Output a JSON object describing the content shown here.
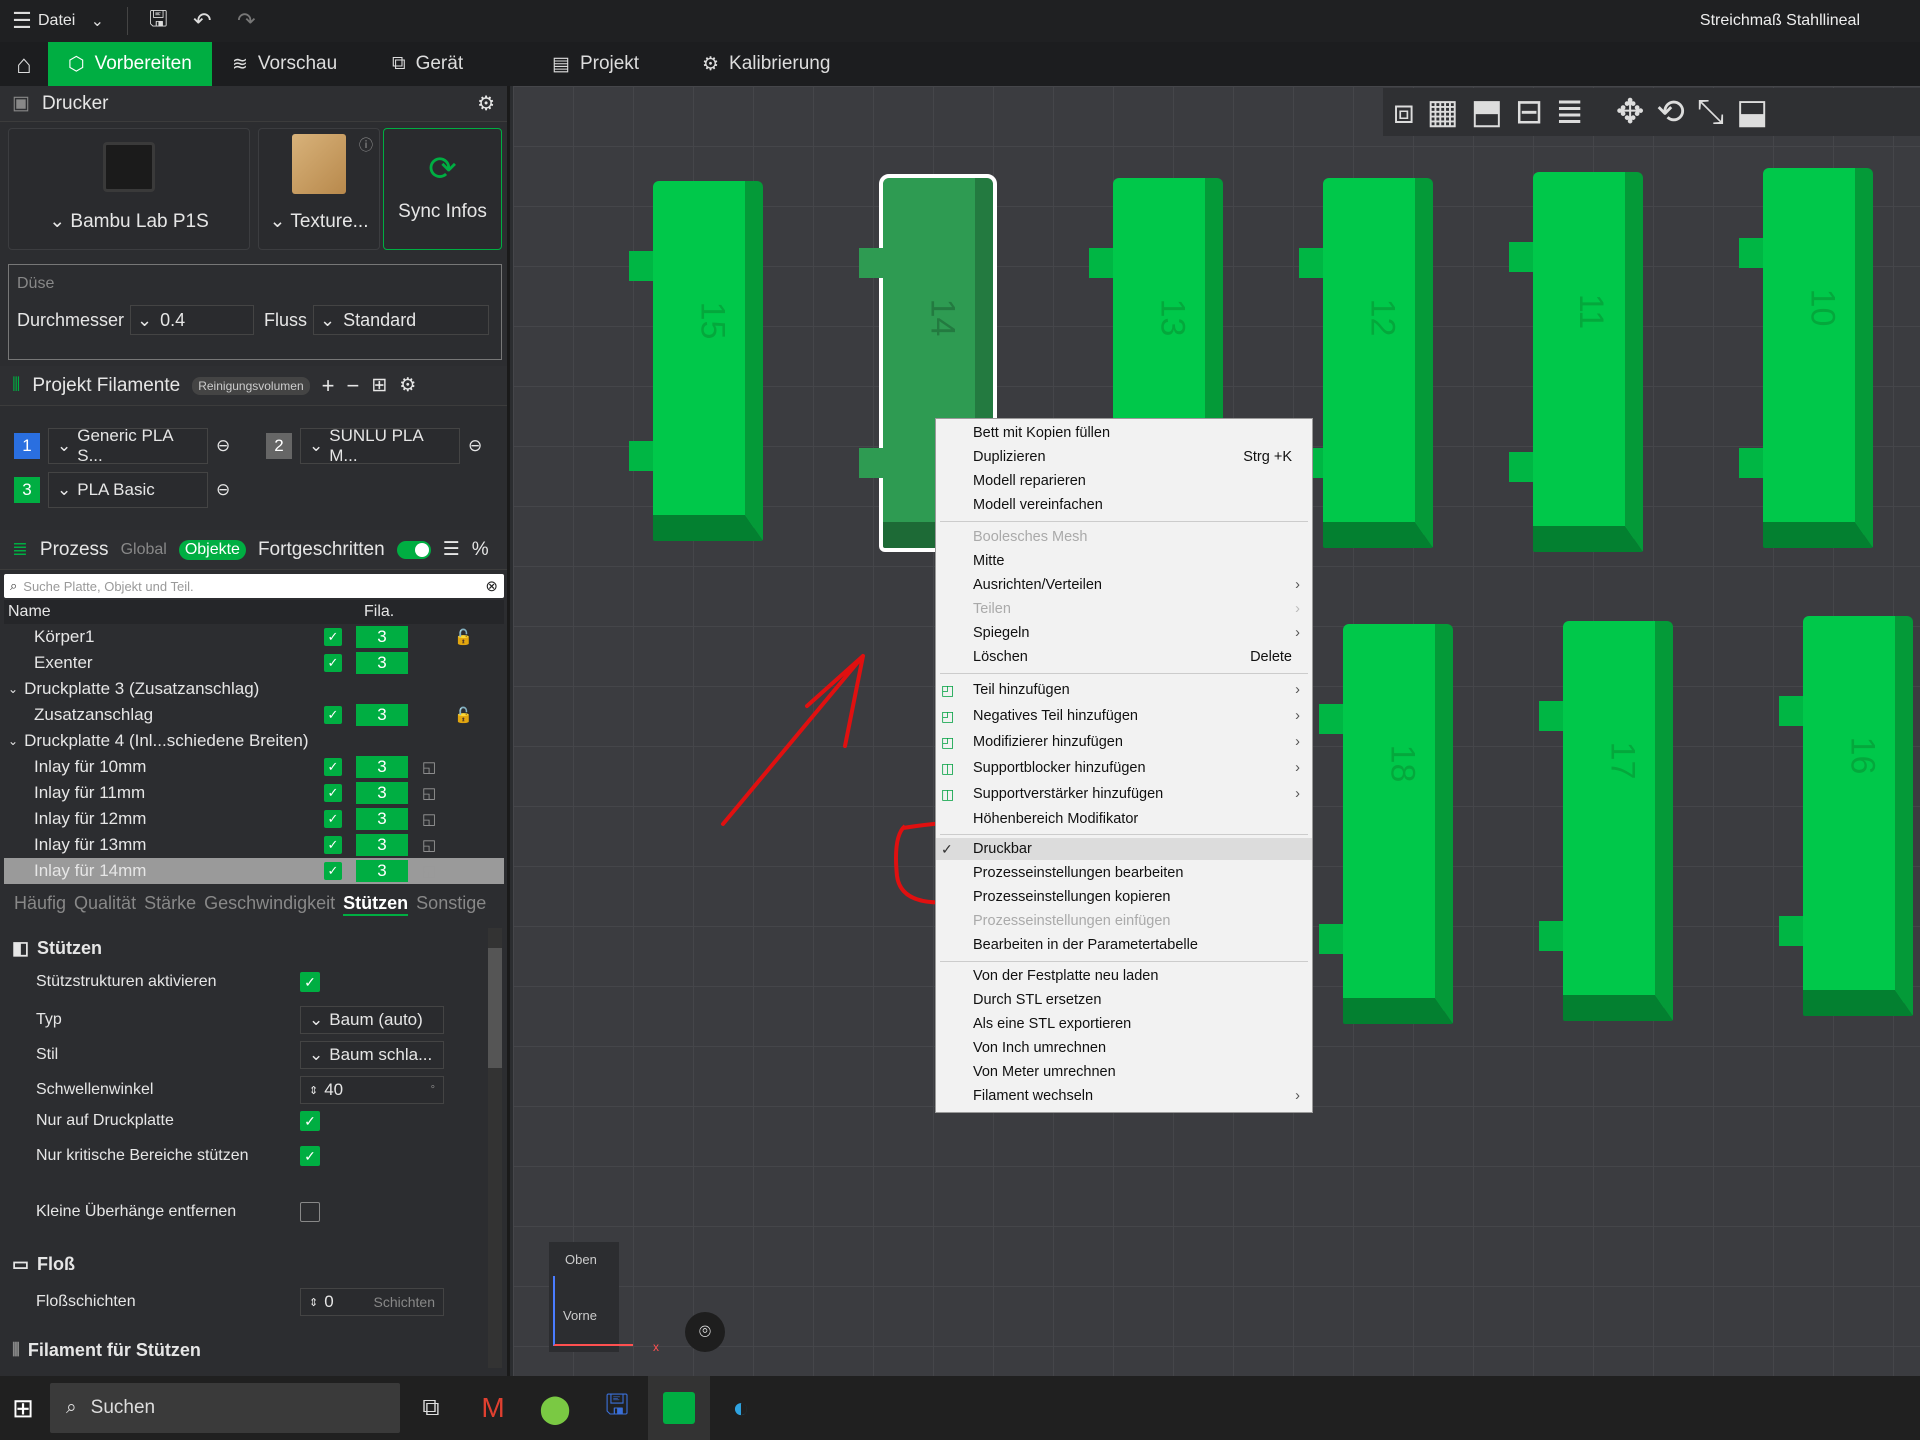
{
  "topbar": {
    "menu": "Datei",
    "title": "Streichmaß Stahllineal"
  },
  "tabs": [
    {
      "label": "Vorbereiten"
    },
    {
      "label": "Vorschau"
    },
    {
      "label": "Gerät"
    },
    {
      "label": "Projekt"
    },
    {
      "label": "Kalibrierung"
    }
  ],
  "printer": {
    "heading": "Drucker",
    "printer_name": "Bambu Lab P1S",
    "plate": "Texture...",
    "sync": "Sync Infos"
  },
  "nozzle": {
    "heading": "Düse",
    "diameter_label": "Durchmesser",
    "diameter_value": "0.4",
    "flow_label": "Fluss",
    "flow_value": "Standard"
  },
  "filaments": {
    "heading": "Projekt Filamente",
    "purge": "Reinigungsvolumen",
    "items": [
      {
        "num": "1",
        "name": "Generic PLA S..."
      },
      {
        "num": "2",
        "name": "SUNLU PLA M..."
      },
      {
        "num": "3",
        "name": "PLA Basic"
      }
    ]
  },
  "process": {
    "heading": "Prozess",
    "global": "Global",
    "objects": "Objekte",
    "advanced": "Fortgeschritten"
  },
  "search": {
    "placeholder": "Suche Platte, Objekt und Teil."
  },
  "tree": {
    "col_name": "Name",
    "col_fila": "Fila.",
    "rows": [
      {
        "name": "Körper1",
        "fila": "3"
      },
      {
        "name": "Exenter",
        "fila": "3"
      },
      {
        "name": "Druckplatte 3 (Zusatzanschlag)"
      },
      {
        "name": "Zusatzanschlag",
        "fila": "3"
      },
      {
        "name": "Druckplatte 4 (Inl...schiedene Breiten)"
      },
      {
        "name": "Inlay für 10mm",
        "fila": "3"
      },
      {
        "name": "Inlay für 11mm",
        "fila": "3"
      },
      {
        "name": "Inlay für 12mm",
        "fila": "3"
      },
      {
        "name": "Inlay für 13mm",
        "fila": "3"
      },
      {
        "name": "Inlay für 14mm",
        "fila": "3"
      }
    ]
  },
  "subtabs": [
    "Häufig",
    "Qualität",
    "Stärke",
    "Geschwindigkeit",
    "Stützen",
    "Sonstige"
  ],
  "support": {
    "heading": "Stützen",
    "enable": "Stützstrukturen aktivieren",
    "type_label": "Typ",
    "type_value": "Baum (auto)",
    "style_label": "Stil",
    "style_value": "Baum schla...",
    "threshold_label": "Schwellenwinkel",
    "threshold_value": "40",
    "threshold_unit": "°",
    "buildplate": "Nur auf Druckplatte",
    "critical": "Nur kritische Bereiche stützen",
    "small": "Kleine Überhänge entfernen"
  },
  "raft": {
    "heading": "Floß",
    "layers_label": "Floßschichten",
    "layers_value": "0",
    "layers_unit": "Schichten"
  },
  "support_filament": {
    "heading": "Filament für Stützen"
  },
  "models": [
    "15",
    "14",
    "13",
    "12",
    "11",
    "10",
    "18",
    "17",
    "16"
  ],
  "axes": {
    "top": "Oben",
    "front": "Vorne",
    "x": "x"
  },
  "context_menu": [
    {
      "label": "Bett mit Kopien füllen"
    },
    {
      "label": "Duplizieren",
      "shortcut": "Strg +K"
    },
    {
      "label": "Modell reparieren"
    },
    {
      "label": "Modell vereinfachen"
    },
    {
      "label": "Boolesches Mesh"
    },
    {
      "label": "Mitte"
    },
    {
      "label": "Ausrichten/Verteilen"
    },
    {
      "label": "Teilen"
    },
    {
      "label": "Spiegeln"
    },
    {
      "label": "Löschen",
      "shortcut": "Delete"
    },
    {
      "label": "Teil hinzufügen"
    },
    {
      "label": "Negatives Teil hinzufügen"
    },
    {
      "label": "Modifizierer hinzufügen"
    },
    {
      "label": "Supportblocker hinzufügen"
    },
    {
      "label": "Supportverstärker hinzufügen"
    },
    {
      "label": "Höhenbereich Modifikator"
    },
    {
      "label": "Druckbar"
    },
    {
      "label": "Prozesseinstellungen bearbeiten"
    },
    {
      "label": "Prozesseinstellungen kopieren"
    },
    {
      "label": "Prozesseinstellungen einfügen"
    },
    {
      "label": "Bearbeiten in der Parametertabelle"
    },
    {
      "label": "Von der Festplatte neu laden"
    },
    {
      "label": "Durch STL ersetzen"
    },
    {
      "label": "Als eine STL exportieren"
    },
    {
      "label": "Von Inch umrechnen"
    },
    {
      "label": "Von Meter umrechnen"
    },
    {
      "label": "Filament wechseln"
    }
  ],
  "taskbar": {
    "search": "Suchen"
  },
  "colors": {
    "accent": "#00ae42",
    "model": "#00c84a",
    "annotation": "#e01010"
  }
}
